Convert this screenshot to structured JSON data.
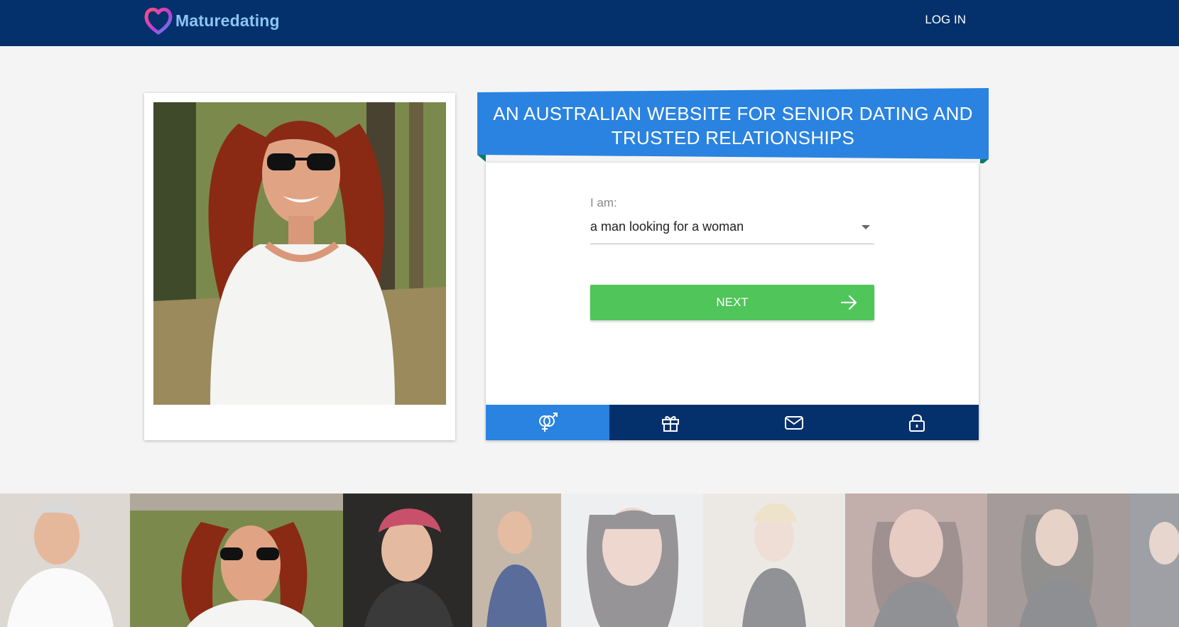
{
  "header": {
    "brand": "Maturedating",
    "login_label": "LOG IN",
    "colors": {
      "bar": "#04316b",
      "brand_text": "#8fc4f4"
    }
  },
  "profile_card": {
    "image": "profile-photo-woman-red-hair-sunglasses"
  },
  "signup": {
    "headline": "AN AUSTRALIAN WEBSITE FOR SENIOR DATING AND TRUSTED RELATIONSHIPS",
    "field_label": "I am:",
    "select_value": "a man looking for a woman",
    "next_label": "NEXT",
    "colors": {
      "ribbon": "#2a83e0",
      "ribbon_fold": "#0b7a6e",
      "next": "#4fc55a"
    }
  },
  "steps": [
    {
      "icon": "gender-icon",
      "active": true
    },
    {
      "icon": "gift-icon",
      "active": false
    },
    {
      "icon": "envelope-icon",
      "active": false
    },
    {
      "icon": "lock-icon",
      "active": false
    }
  ],
  "gallery": {
    "count": 9
  }
}
